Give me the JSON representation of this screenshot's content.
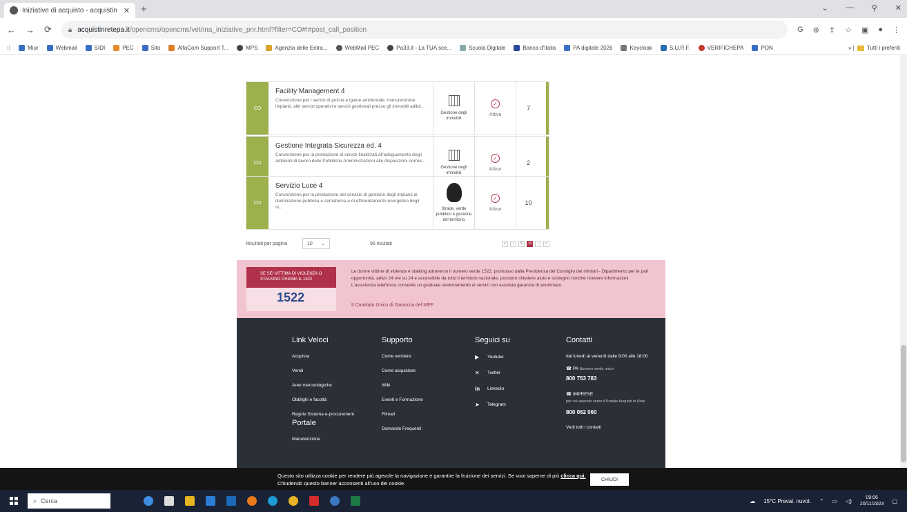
{
  "browser": {
    "tab_title": "Iniziative di acquisto - acquistin",
    "url_domain": "acquistinretepa.it",
    "url_path": "/opencms/opencms/vetrina_iniziative_pnr.html?filter=CO#!#post_call_position",
    "bookmarks": [
      "Miur",
      "Webmail",
      "SIDI",
      "PEC",
      "Sito",
      "AlfaCom Support T...",
      "MPS",
      "Agenzia delle Entra...",
      "WebMail PEC",
      "Pa33.it - La TUA sce...",
      "Scuola Digitale",
      "Banca d'Italia",
      "PA digitale 2026",
      "Keycloak",
      "S.U.R.F.",
      "VERIFICHEPA",
      "PON"
    ],
    "bookmarks_right": "Tutti i preferiti"
  },
  "cards": [
    {
      "tag": "CO",
      "title": "Facility Management 4",
      "desc": "Convenzione per i servizi di pulizia e igiene ambientale, manutenzione impianti, altri servizi operativi e servizi gestionali presso gli immobili adibit...",
      "category": "Gestione degli immobili",
      "category_icon": "building-icon",
      "status": "Attiva",
      "count": "7"
    },
    {
      "tag": "CO",
      "title": "Gestione Integrata Sicurezza ed. 4",
      "desc": "Convenzione per la prestazione di servizi finalizzati all'adeguamento degli ambienti di lavoro delle Pubbliche Amministrazioni alle disposizioni norma...",
      "category": "Gestione degli immobili",
      "category_icon": "building-icon",
      "status": "Attiva",
      "count": "2"
    },
    {
      "tag": "CO",
      "title": "Servizio Luce 4",
      "desc": "Convenzione per la prestazione del servizio di gestione degli impianti di illuminazione pubblica e semaforica e di efficientamento energetico degli st...",
      "category": "Strade, verde pubblico e gestione del territorio",
      "category_icon": "tree-icon",
      "status": "Attiva",
      "count": "10"
    }
  ],
  "pager": {
    "per_page_label": "Risultati per pagina",
    "per_page_value": "10",
    "results": "96 risultati",
    "pages": [
      "«",
      "‹",
      "9",
      "10",
      "›",
      "»"
    ],
    "active_page": "10"
  },
  "banner": {
    "head": "SE SEI VITTIMA DI VIOLENZA O STALKING CHIAMA IL 1522",
    "number": "1522",
    "text": "Le donne vittime di violenza e stalking attraverso il numero verde 1522, promosso dalla Presidenza del Consiglio dei ministri - Dipartimento per le pari opportunità, attivo 24 ore su 24 e accessibile da tutto il territorio nazionale, possono chiedere aiuto e sostegno nonché ricevere informazioni. L'assistenza telefonica consente un graduale avvicinamento ai servizi con assoluta garanzia di anonimato.",
    "link": "Il Comitato Unico di Garanzia del MEF"
  },
  "footer": {
    "link_veloci": {
      "title": "Link Veloci",
      "items": [
        "Acquista",
        "Vendi",
        "Aree merceologiche",
        "Obblighi e facoltà",
        "Regole Sistema e-procurement"
      ]
    },
    "supporto": {
      "title": "Supporto",
      "items": [
        "Come vendere",
        "Come acquistare",
        "Wiki",
        "Eventi e Formazione",
        "Filmati",
        "Domande Frequenti"
      ]
    },
    "seguici": {
      "title": "Seguici su",
      "items": [
        "Youtube",
        "Twitter",
        "Linkedin",
        "Telegram"
      ]
    },
    "contatti": {
      "title": "Contatti",
      "hours": "dal lunedì al venerdì dalle 9:00 alle 18:00",
      "pa_label": "PA",
      "pa_sub": "Numero verde unico",
      "pa_number": "800 753 783",
      "imprese_label": "IMPRESE",
      "imprese_sub": "per voi aziende verso il Portale Acquisti in Rete",
      "imprese_number": "800 062 060",
      "all_contacts": "Vedi tutti i contatti"
    },
    "portale": {
      "title": "Portale",
      "items": [
        "Manutenzione"
      ]
    }
  },
  "cookie": {
    "text1": "Questo sito utilizza cookie per rendere più agevole la navigazione e garantire la fruizione dei servizi. Se vuoi saperne di più",
    "link": "clicca qui.",
    "text2": "Chiudendo questo banner acconsenti all'uso dei cookie.",
    "button": "CHIUDI"
  },
  "taskbar": {
    "search_placeholder": "Cerca",
    "weather": "15°C Preval. nuvol.",
    "time": "09:06",
    "date": "20/11/2023"
  }
}
